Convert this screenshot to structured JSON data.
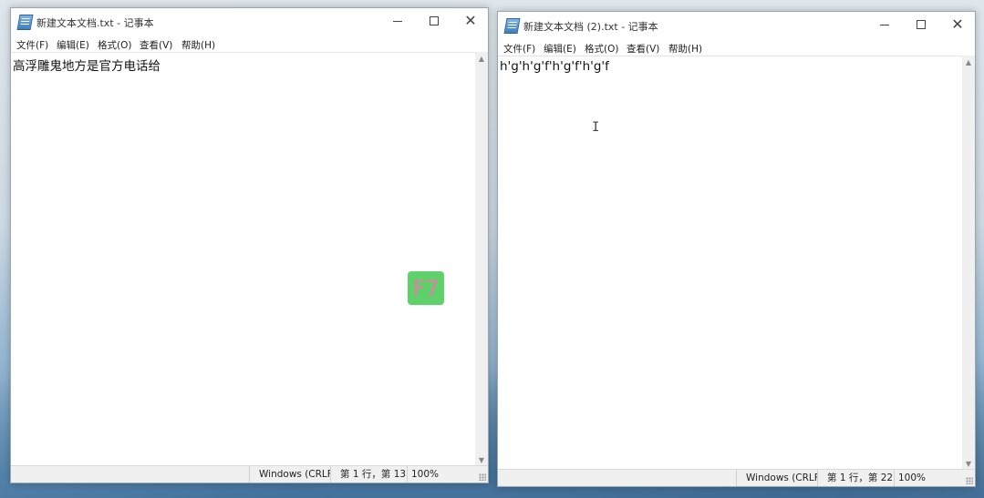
{
  "window_left": {
    "title": "新建文本文档.txt - 记事本",
    "menu": [
      "文件(F)",
      "编辑(E)",
      "格式(O)",
      "查看(V)",
      "帮助(H)"
    ],
    "content": "高浮雕鬼地方是官方电话给",
    "status": {
      "encoding": "Windows (CRLF",
      "position": "第 1 行，第 13",
      "zoom": "100%"
    }
  },
  "window_right": {
    "title": "新建文本文档 (2).txt - 记事本",
    "menu": [
      "文件(F)",
      "编辑(E)",
      "格式(O)",
      "查看(V)",
      "帮助(H)"
    ],
    "content": "h'g'h'g'f'h'g'f'h'g'f",
    "status": {
      "encoding": "Windows (CRLF",
      "position": "第 1 行，第 22",
      "zoom": "100%"
    }
  },
  "overlay": {
    "key_badge": "F7",
    "key_badge_color": "#5fd16a",
    "key_text_color": "#e879a8"
  },
  "icons": {
    "minimize": "minimize-icon",
    "maximize": "maximize-icon",
    "close": "close-icon"
  }
}
